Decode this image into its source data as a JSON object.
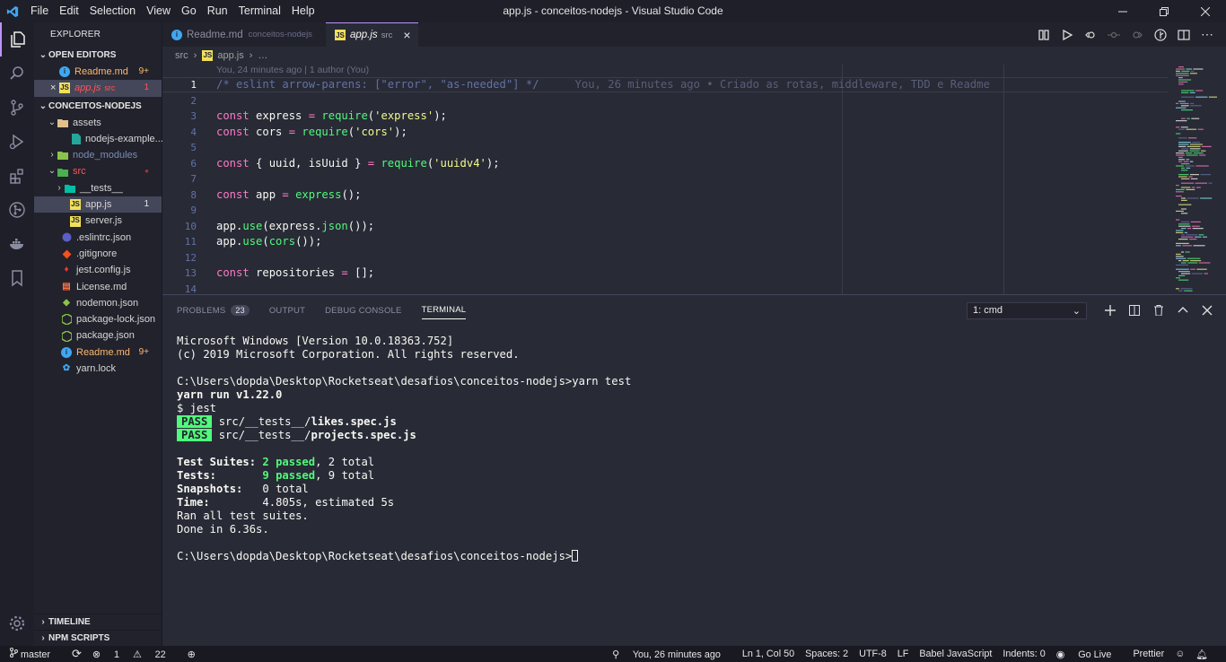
{
  "window": {
    "title": "app.js - conceitos-nodejs - Visual Studio Code",
    "menu": [
      "File",
      "Edit",
      "Selection",
      "View",
      "Go",
      "Run",
      "Terminal",
      "Help"
    ]
  },
  "explorer": {
    "title": "EXPLORER",
    "open_editors": {
      "label": "OPEN EDITORS",
      "items": [
        {
          "name": "Readme.md",
          "desc": "",
          "badge": "9+",
          "color": "#ffb86c"
        },
        {
          "name": "app.js",
          "desc": "src",
          "badge": "1",
          "color": "#ff5555"
        }
      ]
    },
    "project": {
      "label": "CONCEITOS-NODEJS",
      "items": [
        {
          "name": "assets",
          "badge": ""
        },
        {
          "name": "nodejs-example....",
          "badge": ""
        },
        {
          "name": "node_modules",
          "badge": ""
        },
        {
          "name": "src",
          "badge": "●"
        },
        {
          "name": "__tests__",
          "badge": ""
        },
        {
          "name": "app.js",
          "badge": "1"
        },
        {
          "name": "server.js",
          "badge": ""
        },
        {
          "name": ".eslintrc.json",
          "badge": ""
        },
        {
          "name": ".gitignore",
          "badge": ""
        },
        {
          "name": "jest.config.js",
          "badge": ""
        },
        {
          "name": "License.md",
          "badge": ""
        },
        {
          "name": "nodemon.json",
          "badge": ""
        },
        {
          "name": "package-lock.json",
          "badge": ""
        },
        {
          "name": "package.json",
          "badge": ""
        },
        {
          "name": "Readme.md",
          "badge": "9+"
        },
        {
          "name": "yarn.lock",
          "badge": ""
        }
      ]
    },
    "timeline": "TIMELINE",
    "npm_scripts": "NPM SCRIPTS"
  },
  "tabs": [
    {
      "name": "Readme.md",
      "desc": "conceitos-nodejs"
    },
    {
      "name": "app.js",
      "desc": "src",
      "close": "×"
    }
  ],
  "breadcrumb": {
    "a": "src",
    "sep": "›",
    "b": "app.js",
    "c": "…"
  },
  "codelens": "You, 24 minutes ago | 1 author (You)",
  "code": {
    "line1": "/* eslint arrow-parens: [\"error\", \"as-needed\"] */",
    "blame": "You, 26 minutes ago • Criado as rotas, middleware, TDD e Readme",
    "line_numbers": [
      "1",
      "2",
      "3",
      "4",
      "5",
      "6",
      "7",
      "8",
      "9",
      "10",
      "11",
      "12",
      "13",
      "14"
    ]
  },
  "panel": {
    "tabs": [
      "PROBLEMS",
      "OUTPUT",
      "DEBUG CONSOLE",
      "TERMINAL"
    ],
    "problems_count": "23",
    "terminal_select": "1: cmd"
  },
  "terminal": {
    "l1": "Microsoft Windows [Version 10.0.18363.752]",
    "l2": "(c) 2019 Microsoft Corporation. All rights reserved.",
    "l3": "C:\\Users\\dopda\\Desktop\\Rocketseat\\desafios\\conceitos-nodejs>yarn test",
    "l4": "yarn run v1.22.0",
    "l5": "$ jest",
    "pass": "PASS",
    "spec1_dir": "src/__tests__/",
    "spec1_file": "likes.spec.js",
    "spec2_dir": "src/__tests__/",
    "spec2_file": "projects.spec.js",
    "suites_label": "Test Suites: ",
    "suites_passed": "2 passed",
    "suites_total": ", 2 total",
    "tests_label": "Tests:       ",
    "tests_passed": "9 passed",
    "tests_total": ", 9 total",
    "snap_label": "Snapshots:   ",
    "snap_val": "0 total",
    "time_label": "Time:        ",
    "time_val": "4.805s, estimated 5s",
    "ran": "Ran all test suites.",
    "done": "Done in 6.36s.",
    "prompt": "C:\\Users\\dopda\\Desktop\\Rocketseat\\desafios\\conceitos-nodejs>"
  },
  "status": {
    "branch": "master",
    "errors": "1",
    "warnings": "22",
    "blame": "You, 26 minutes ago",
    "position": "Ln 1, Col 50",
    "spaces": "Spaces: 2",
    "encoding": "UTF-8",
    "eol": "LF",
    "language": "Babel JavaScript",
    "indents": "Indents: 0",
    "golive": "Go Live",
    "prettier": "Prettier"
  },
  "colors": {
    "accent": "#bd93f9",
    "green": "#50fa7b",
    "pink": "#ff79c6",
    "yellow": "#f1fa8c",
    "orange": "#ffb86c",
    "red": "#ff5555"
  }
}
